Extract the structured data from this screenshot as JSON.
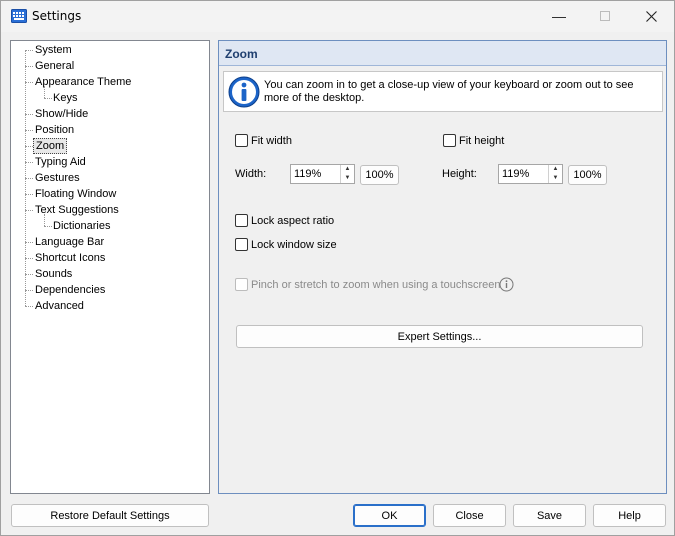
{
  "window": {
    "title": "Settings",
    "app_icon": "keyboard-icon",
    "minimize_icon": "minimize-icon",
    "maximize_icon": "maximize-icon",
    "close_icon": "close-icon"
  },
  "sidebar": {
    "items": [
      {
        "label": "System",
        "level": 0
      },
      {
        "label": "General",
        "level": 0
      },
      {
        "label": "Appearance Theme",
        "level": 0
      },
      {
        "label": "Keys",
        "level": 1
      },
      {
        "label": "Show/Hide",
        "level": 0
      },
      {
        "label": "Position",
        "level": 0
      },
      {
        "label": "Zoom",
        "level": 0,
        "selected": true
      },
      {
        "label": "Typing Aid",
        "level": 0
      },
      {
        "label": "Gestures",
        "level": 0
      },
      {
        "label": "Floating Window",
        "level": 0
      },
      {
        "label": "Text Suggestions",
        "level": 0
      },
      {
        "label": "Dictionaries",
        "level": 1
      },
      {
        "label": "Language Bar",
        "level": 0
      },
      {
        "label": "Shortcut Icons",
        "level": 0
      },
      {
        "label": "Sounds",
        "level": 0
      },
      {
        "label": "Dependencies",
        "level": 0
      },
      {
        "label": "Advanced",
        "level": 0
      }
    ]
  },
  "panel": {
    "title": "Zoom",
    "info": "You can zoom in to get a close-up view of your keyboard or zoom out to see more of the desktop.",
    "fit_width": {
      "label": "Fit width",
      "checked": false
    },
    "fit_height": {
      "label": "Fit height",
      "checked": false
    },
    "width": {
      "label": "Width:",
      "value": "119%",
      "reset": "100%"
    },
    "height": {
      "label": "Height:",
      "value": "119%",
      "reset": "100%"
    },
    "lock_aspect": {
      "label": "Lock aspect ratio",
      "checked": false
    },
    "lock_size": {
      "label": "Lock window size",
      "checked": false
    },
    "pinch": {
      "label": "Pinch or stretch to zoom when using a touchscreen",
      "checked": false,
      "enabled": false
    },
    "expert_button": "Expert Settings..."
  },
  "footer": {
    "restore": "Restore Default Settings",
    "ok": "OK",
    "close": "Close",
    "save": "Save",
    "help": "Help"
  }
}
